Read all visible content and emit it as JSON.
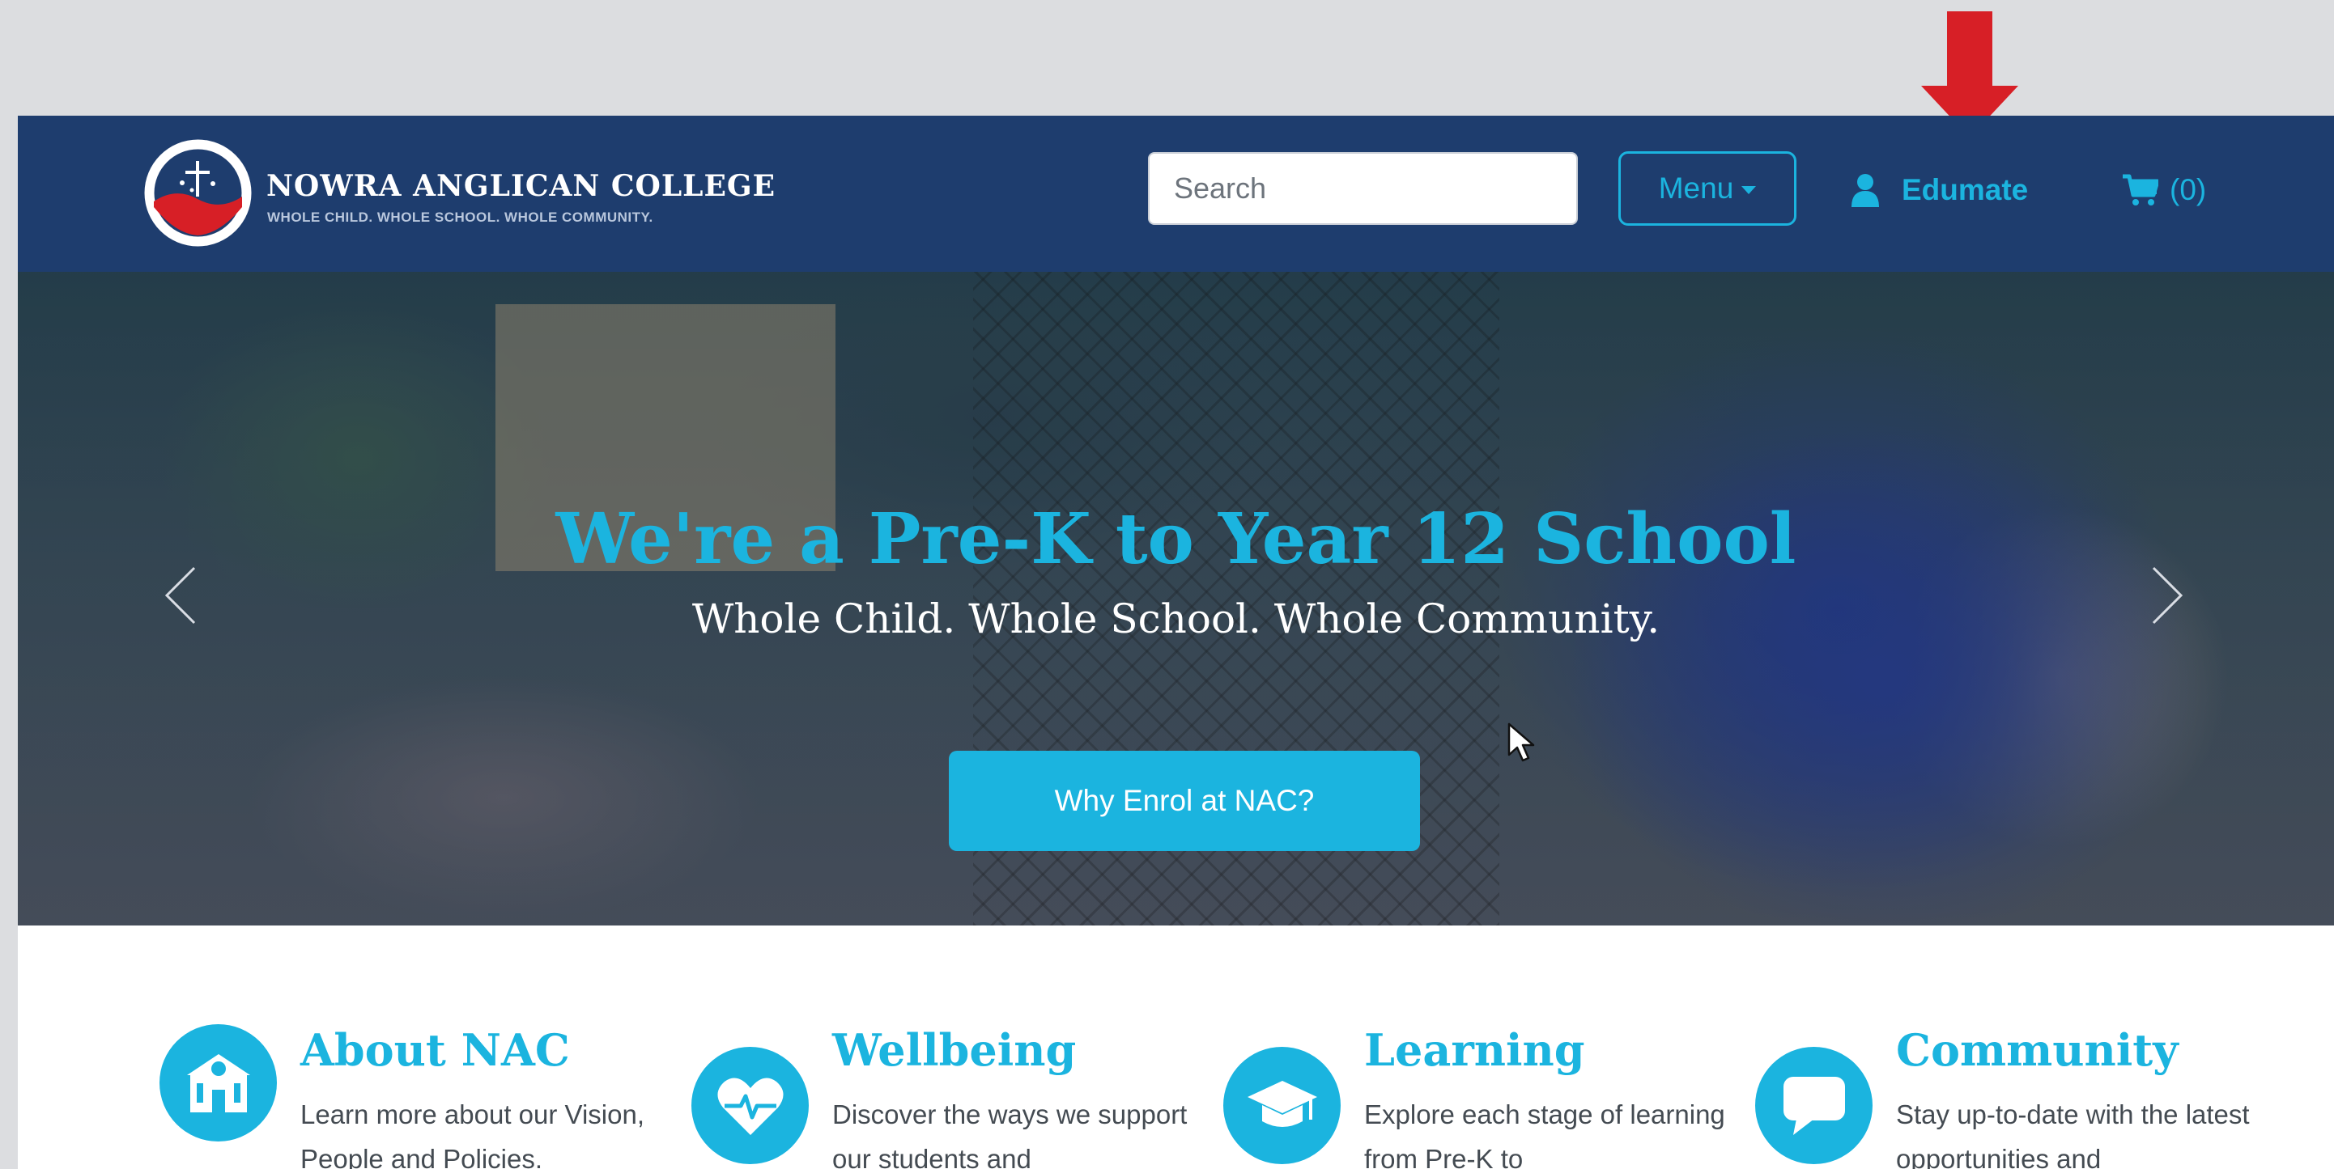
{
  "header": {
    "brand_name": "NOWRA ANGLICAN COLLEGE",
    "brand_tagline": "WHOLE CHILD. WHOLE SCHOOL. WHOLE COMMUNITY.",
    "search_placeholder": "Search",
    "menu_label": "Menu",
    "edumate_label": "Edumate",
    "cart_label": "(0)"
  },
  "hero": {
    "title": "We're a Pre-K to Year 12 School",
    "subtitle": "Whole Child. Whole School. Whole Community.",
    "cta_label": "Why Enrol at NAC?"
  },
  "features": [
    {
      "title": "About NAC",
      "text": "Learn more about our Vision, People and Policies.",
      "icon": "school-building-icon"
    },
    {
      "title": "Wellbeing",
      "text": "Discover the ways we support our students and",
      "icon": "heart-pulse-icon"
    },
    {
      "title": "Learning",
      "text": "Explore each stage of learning from Pre-K to",
      "icon": "graduation-cap-icon"
    },
    {
      "title": "Community",
      "text": "Stay up-to-date with the latest opportunities and",
      "icon": "speech-bubble-icon"
    }
  ],
  "colors": {
    "header_bg": "#1e3d6e",
    "accent": "#1bb4df",
    "arrow": "#d71f26"
  }
}
